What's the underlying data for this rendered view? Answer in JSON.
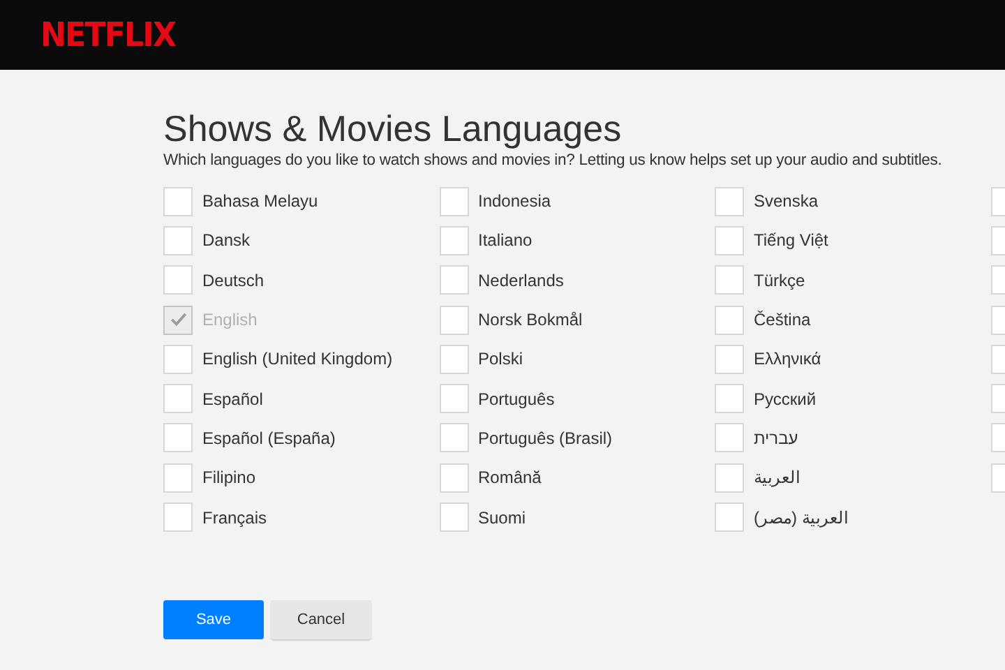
{
  "header": {
    "logo": "NETFLIX"
  },
  "title": "Shows & Movies Languages",
  "subtitle": "Which languages do you like to watch shows and movies in? Letting us know helps set up your audio and subtitles.",
  "columns": [
    [
      {
        "label": "Bahasa Melayu",
        "checked": false,
        "disabled": false
      },
      {
        "label": "Dansk",
        "checked": false,
        "disabled": false
      },
      {
        "label": "Deutsch",
        "checked": false,
        "disabled": false
      },
      {
        "label": "English",
        "checked": true,
        "disabled": true
      },
      {
        "label": "English (United Kingdom)",
        "checked": false,
        "disabled": false
      },
      {
        "label": "Español",
        "checked": false,
        "disabled": false
      },
      {
        "label": "Español (España)",
        "checked": false,
        "disabled": false
      },
      {
        "label": "Filipino",
        "checked": false,
        "disabled": false
      },
      {
        "label": "Français",
        "checked": false,
        "disabled": false
      }
    ],
    [
      {
        "label": "Indonesia",
        "checked": false,
        "disabled": false
      },
      {
        "label": "Italiano",
        "checked": false,
        "disabled": false
      },
      {
        "label": "Nederlands",
        "checked": false,
        "disabled": false
      },
      {
        "label": "Norsk Bokmål",
        "checked": false,
        "disabled": false
      },
      {
        "label": "Polski",
        "checked": false,
        "disabled": false
      },
      {
        "label": "Português",
        "checked": false,
        "disabled": false
      },
      {
        "label": "Português (Brasil)",
        "checked": false,
        "disabled": false
      },
      {
        "label": "Română",
        "checked": false,
        "disabled": false
      },
      {
        "label": "Suomi",
        "checked": false,
        "disabled": false
      }
    ],
    [
      {
        "label": "Svenska",
        "checked": false,
        "disabled": false
      },
      {
        "label": "Tiếng Việt",
        "checked": false,
        "disabled": false
      },
      {
        "label": "Türkçe",
        "checked": false,
        "disabled": false
      },
      {
        "label": "Čeština",
        "checked": false,
        "disabled": false
      },
      {
        "label": "Ελληνικά",
        "checked": false,
        "disabled": false
      },
      {
        "label": "Русский",
        "checked": false,
        "disabled": false
      },
      {
        "label": "עברית",
        "checked": false,
        "disabled": false
      },
      {
        "label": "العربية",
        "checked": false,
        "disabled": false
      },
      {
        "label": "العربية (مصر)",
        "checked": false,
        "disabled": false
      }
    ],
    [
      {
        "checked": false,
        "disabled": false
      },
      {
        "checked": false,
        "disabled": false
      },
      {
        "checked": false,
        "disabled": false
      },
      {
        "checked": false,
        "disabled": false
      },
      {
        "checked": false,
        "disabled": false
      },
      {
        "checked": false,
        "disabled": false
      },
      {
        "checked": false,
        "disabled": false
      },
      {
        "checked": false,
        "disabled": false
      }
    ]
  ],
  "buttons": [
    {
      "label": "Save",
      "kind": "primary"
    },
    {
      "label": "Cancel",
      "kind": "secondary"
    }
  ]
}
